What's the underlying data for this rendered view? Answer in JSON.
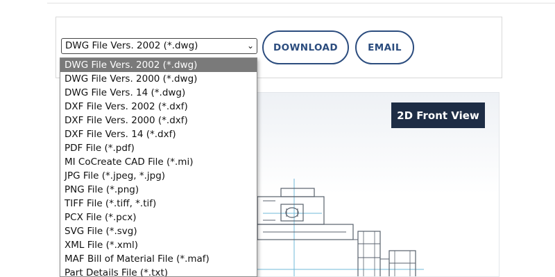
{
  "format_select": {
    "value": "DWG File Vers. 2002 (*.dwg)",
    "options": [
      "DWG File Vers. 2002 (*.dwg)",
      "DWG File Vers. 2000 (*.dwg)",
      "DWG File Vers. 14 (*.dwg)",
      "DXF File Vers. 2002 (*.dxf)",
      "DXF File Vers. 2000 (*.dxf)",
      "DXF File Vers. 14 (*.dxf)",
      "PDF File (*.pdf)",
      "MI CoCreate CAD File (*.mi)",
      "JPG File (*.jpeg, *.jpg)",
      "PNG File (*.png)",
      "TIFF File (*.tiff, *.tif)",
      "PCX File (*.pcx)",
      "SVG File (*.svg)",
      "XML File (*.xml)",
      "MAF Bill of Material File (*.maf)",
      "Part Details File (*.txt)"
    ],
    "selected_index": 0
  },
  "actions": {
    "download_label": "DOWNLOAD",
    "email_label": "EMAIL"
  },
  "viewer": {
    "view_label": "2D Front View"
  },
  "colors": {
    "accent": "#2b4c7e",
    "label_bg": "#1e2d45",
    "selected_bg": "#7a7a7a",
    "drawing_line": "#58606c",
    "center_line": "#6fb8d8"
  }
}
